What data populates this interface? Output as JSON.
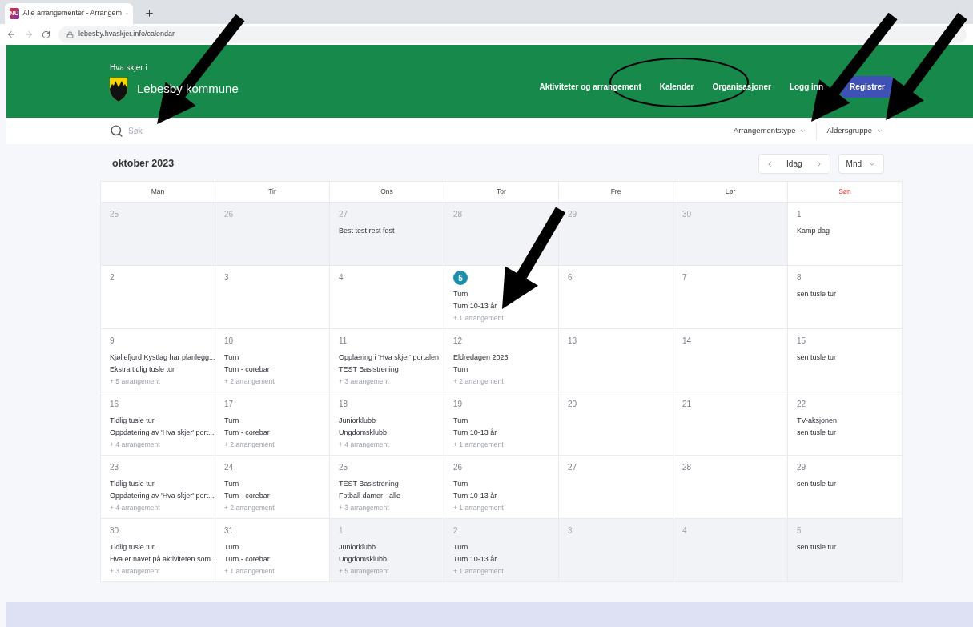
{
  "browser": {
    "tab_title": "Alle arrangementer - Arrangem",
    "favicon": "NU",
    "url": "lebesby.hvaskjer.info/calendar"
  },
  "header": {
    "tagline": "Hva skjer i",
    "site_name": "Lebesby kommune",
    "nav": [
      {
        "label": "Aktiviteter og arrangement",
        "kind": "link"
      },
      {
        "label": "Kalender",
        "kind": "link"
      },
      {
        "label": "Organisasjoner",
        "kind": "link"
      },
      {
        "label": "Logg inn",
        "kind": "link"
      },
      {
        "label": "Registrer",
        "kind": "primary"
      }
    ]
  },
  "search": {
    "placeholder": "Søk"
  },
  "filters": [
    "Arrangementstype",
    "Aldersgruppe"
  ],
  "calendar": {
    "title": "oktober 2023",
    "today_button": "Idag",
    "view_select": "Mnd",
    "weekdays": [
      {
        "label": "Man",
        "weekend": false
      },
      {
        "label": "Tir",
        "weekend": false
      },
      {
        "label": "Ons",
        "weekend": false
      },
      {
        "label": "Tor",
        "weekend": false
      },
      {
        "label": "Fre",
        "weekend": false
      },
      {
        "label": "Lør",
        "weekend": false
      },
      {
        "label": "Søn",
        "weekend": true
      }
    ],
    "weeks": [
      [
        {
          "day": "25",
          "outside_month": true,
          "today": false
        },
        {
          "day": "26",
          "outside_month": true,
          "today": false
        },
        {
          "day": "27",
          "outside_month": true,
          "today": false,
          "events": [
            "Best test rest fest"
          ]
        },
        {
          "day": "28",
          "outside_month": true,
          "today": false
        },
        {
          "day": "29",
          "outside_month": true,
          "today": false
        },
        {
          "day": "30",
          "outside_month": true,
          "today": false
        },
        {
          "day": "1",
          "outside_month": false,
          "today": false,
          "events": [
            "Kamp dag"
          ]
        }
      ],
      [
        {
          "day": "2",
          "outside_month": false,
          "today": false
        },
        {
          "day": "3",
          "outside_month": false,
          "today": false
        },
        {
          "day": "4",
          "outside_month": false,
          "today": false
        },
        {
          "day": "5",
          "outside_month": false,
          "today": true,
          "events": [
            "Turn",
            "Turn 10-13 år"
          ],
          "more": "+ 1 arrangement"
        },
        {
          "day": "6",
          "outside_month": false,
          "today": false
        },
        {
          "day": "7",
          "outside_month": false,
          "today": false
        },
        {
          "day": "8",
          "outside_month": false,
          "today": false,
          "events": [
            "sen tusle tur"
          ]
        }
      ],
      [
        {
          "day": "9",
          "outside_month": false,
          "today": false,
          "events": [
            "Kjøllefjord Kystlag har planlegg...",
            "Ekstra tidlig tusle tur"
          ],
          "more": "+ 5 arrangement"
        },
        {
          "day": "10",
          "outside_month": false,
          "today": false,
          "events": [
            "Turn",
            "Turn - corebar"
          ],
          "more": "+ 2 arrangement"
        },
        {
          "day": "11",
          "outside_month": false,
          "today": false,
          "events": [
            "Opplæring i 'Hva skjer' portalen",
            "TEST Basistrening"
          ],
          "more": "+ 3 arrangement"
        },
        {
          "day": "12",
          "outside_month": false,
          "today": false,
          "events": [
            "Eldredagen 2023",
            "Turn"
          ],
          "more": "+ 2 arrangement"
        },
        {
          "day": "13",
          "outside_month": false,
          "today": false
        },
        {
          "day": "14",
          "outside_month": false,
          "today": false
        },
        {
          "day": "15",
          "outside_month": false,
          "today": false,
          "events": [
            "sen tusle tur"
          ]
        }
      ],
      [
        {
          "day": "16",
          "outside_month": false,
          "today": false,
          "events": [
            "Tidlig tusle tur",
            "Oppdatering av 'Hva skjer' port..."
          ],
          "more": "+ 4 arrangement"
        },
        {
          "day": "17",
          "outside_month": false,
          "today": false,
          "events": [
            "Turn",
            "Turn - corebar"
          ],
          "more": "+ 2 arrangement"
        },
        {
          "day": "18",
          "outside_month": false,
          "today": false,
          "events": [
            "Juniorklubb",
            "Ungdomsklubb"
          ],
          "more": "+ 4 arrangement"
        },
        {
          "day": "19",
          "outside_month": false,
          "today": false,
          "events": [
            "Turn",
            "Turn 10-13 år"
          ],
          "more": "+ 1 arrangement"
        },
        {
          "day": "20",
          "outside_month": false,
          "today": false
        },
        {
          "day": "21",
          "outside_month": false,
          "today": false
        },
        {
          "day": "22",
          "outside_month": false,
          "today": false,
          "events": [
            "TV-aksjonen",
            "sen tusle tur"
          ]
        }
      ],
      [
        {
          "day": "23",
          "outside_month": false,
          "today": false,
          "events": [
            "Tidlig tusle tur",
            "Oppdatering av 'Hva skjer' port..."
          ],
          "more": "+ 4 arrangement"
        },
        {
          "day": "24",
          "outside_month": false,
          "today": false,
          "events": [
            "Turn",
            "Turn - corebar"
          ],
          "more": "+ 2 arrangement"
        },
        {
          "day": "25",
          "outside_month": false,
          "today": false,
          "events": [
            "TEST Basistrening",
            "Fotball damer - alle"
          ],
          "more": "+ 3 arrangement"
        },
        {
          "day": "26",
          "outside_month": false,
          "today": false,
          "events": [
            "Turn",
            "Turn 10-13 år"
          ],
          "more": "+ 1 arrangement"
        },
        {
          "day": "27",
          "outside_month": false,
          "today": false
        },
        {
          "day": "28",
          "outside_month": false,
          "today": false
        },
        {
          "day": "29",
          "outside_month": false,
          "today": false,
          "events": [
            "sen tusle tur"
          ]
        }
      ],
      [
        {
          "day": "30",
          "outside_month": false,
          "today": false,
          "events": [
            "Tidlig tusle tur",
            "Hva er navet på aktiviteten som..."
          ],
          "more": "+ 3 arrangement"
        },
        {
          "day": "31",
          "outside_month": false,
          "today": false,
          "events": [
            "Turn",
            "Turn - corebar"
          ],
          "more": "+ 1 arrangement"
        },
        {
          "day": "1",
          "outside_month": true,
          "today": false,
          "events": [
            "Juniorklubb",
            "Ungdomsklubb"
          ],
          "more": "+ 5 arrangement"
        },
        {
          "day": "2",
          "outside_month": true,
          "today": false,
          "events": [
            "Turn",
            "Turn 10-13 år"
          ],
          "more": "+ 1 arrangement"
        },
        {
          "day": "3",
          "outside_month": true,
          "today": false
        },
        {
          "day": "4",
          "outside_month": true,
          "today": false
        },
        {
          "day": "5",
          "outside_month": true,
          "today": false,
          "events": [
            "sen tusle tur"
          ]
        }
      ]
    ]
  }
}
